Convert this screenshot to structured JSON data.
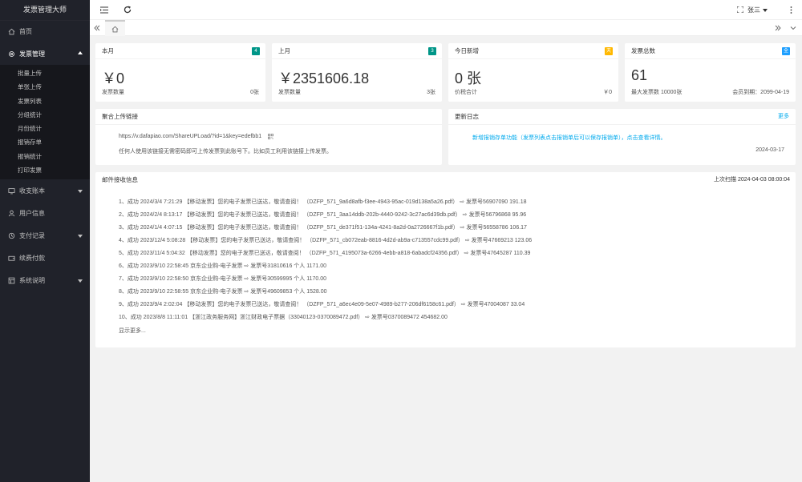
{
  "sidebar": {
    "logo": "发票管理大师",
    "items": [
      {
        "label": "首页"
      },
      {
        "label": "发票管理"
      },
      {
        "label": "收支账本"
      },
      {
        "label": "用户信息"
      },
      {
        "label": "支付记录"
      },
      {
        "label": "续费付款"
      },
      {
        "label": "系统说明"
      }
    ],
    "sub_items": [
      "批量上传",
      "单张上传",
      "发票列表",
      "分组统计",
      "月份统计",
      "报销存单",
      "报销统计",
      "打印发票"
    ]
  },
  "header": {
    "user_name": "张三"
  },
  "stats": [
    {
      "title": "本月",
      "badge": "4",
      "badge_color": "#009688",
      "value": "￥0",
      "left_label": "发票数量",
      "right_value": "0张"
    },
    {
      "title": "上月",
      "badge": "3",
      "badge_color": "#009688",
      "value": "￥2351606.18",
      "left_label": "发票数量",
      "right_value": "3张"
    },
    {
      "title": "今日新增",
      "badge": "天",
      "badge_color": "#ffb800",
      "value": "0 张",
      "left_label": "价税合计",
      "right_value": "￥0"
    },
    {
      "title": "发票总数",
      "badge": "全",
      "badge_color": "#1e9fff",
      "value": "61",
      "left_label": "最大发票数 10000张",
      "right_value": "会员到期：2099-04-19"
    }
  ],
  "upload_link": {
    "title": "聚合上传链接",
    "url": "https://v.dafapiao.com/ShareUPLoad/?id=1&key=edefbb1",
    "note": "任何人使用该链接无需密码即可上传发票到此账号下。比如员工利用该链接上传发票。"
  },
  "changelog": {
    "title": "更新日志",
    "more": "更多",
    "entry": "新增报销存单功能（发票列表点击报销单后可以保存报销单），点击查看详情。",
    "date": "2024-03-17"
  },
  "mail": {
    "title": "邮件接收信息",
    "last_scan": "上次扫描 2024-04-03 08:00:04",
    "lines": [
      "1、成功 2024/3/4 7:21:29 【移动发票】您的电子发票已送达，敬请查阅！ （DZFP_571_9a6d8afb-f3ee-4943-95ac-019d138a5a26.pdf） ⇨ 发票号56907090 191.18",
      "2、成功 2024/2/4 8:13:17 【移动发票】您的电子发票已送达，敬请查阅！ （DZFP_571_3aa14ddb-202b-4440-9242-3c27ac6d39db.pdf） ⇨ 发票号56796868 95.96",
      "3、成功 2024/1/4 4:07:15 【移动发票】您的电子发票已送达，敬请查阅！ （DZFP_571_de371f51-134a-4241-8a2d-0a2726667f1b.pdf） ⇨ 发票号56558786 106.17",
      "4、成功 2023/12/4 5:08:28 【移动发票】您的电子发票已送达，敬请查阅！ （DZFP_571_cb072eab-8816-4d2d-ab9a-c713557cdc99.pdf） ⇨ 发票号47669213 123.06",
      "5、成功 2023/11/4 5:04:32 【移动发票】您的电子发票已送达，敬请查阅！ （DZFP_571_4195073a-6266-4ebb-a818-6abadcf24356.pdf） ⇨ 发票号47645287 110.39",
      "6、成功 2023/9/10 22:58:45 京东企业购-电子发票 ⇨ 发票号31810616 个人 1171.00",
      "7、成功 2023/9/10 22:58:50 京东企业购-电子发票 ⇨ 发票号30599995 个人 1170.00",
      "8、成功 2023/9/10 22:58:55 京东企业购-电子发票 ⇨ 发票号49609853 个人 1528.00",
      "9、成功 2023/9/4 2:02:04 【移动发票】您的电子发票已送达，敬请查阅！ （DZFP_571_a6ec4e09-5e07-4989-b277-206df6158c61.pdf） ⇨ 发票号47004087 33.04",
      "10、成功 2023/8/8 11:11:01 【浙江政务服务网】浙江财政电子票据（33040123-0370089472.pdf） ⇨ 发票号0370089472 454682.00"
    ],
    "show_more": "显示更多..."
  }
}
